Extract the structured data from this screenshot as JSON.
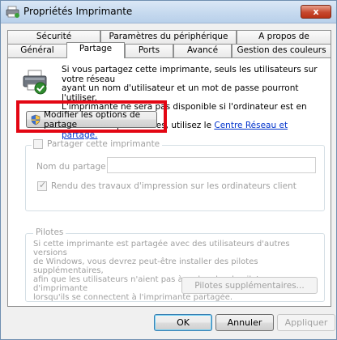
{
  "window": {
    "title": "Propriétés Imprimante",
    "close_label": "x"
  },
  "tabs": {
    "row1": [
      {
        "label": "Sécurité"
      },
      {
        "label": "Paramètres du périphérique"
      },
      {
        "label": "A propos de"
      }
    ],
    "row2": [
      {
        "label": "Général"
      },
      {
        "label": "Partage",
        "active": true
      },
      {
        "label": "Ports"
      },
      {
        "label": "Avancé"
      },
      {
        "label": "Gestion des couleurs"
      }
    ]
  },
  "sharing": {
    "info_line1": "Si vous partagez cette imprimante, seuls les utilisateurs sur votre réseau",
    "info_line2": "ayant un nom d'utilisateur et un mot de passe pourront l'utiliser.",
    "info_line3": "L'imprimante ne sera pas disponible si l'ordinateur est en veille. Pour",
    "info_line4": "modifier ces paramètres, utilisez le",
    "info_link": "Centre Réseau et partage.",
    "modify_button": "Modifier les options de partage",
    "share_checkbox_label": "Partager cette imprimante",
    "share_checkbox_checked": false,
    "share_name_label": "Nom du partage :",
    "share_name_value": "",
    "render_label": "Rendu des travaux d'impression sur les ordinateurs client",
    "render_checked": true
  },
  "drivers": {
    "title": "Pilotes",
    "line1": "Si cette imprimante est partagée avec des utilisateurs d'autres versions",
    "line2": "de Windows, vous devrez peut-être installer des pilotes supplémentaires,",
    "line3": "afin que les utilisateurs n'aient pas à rechercher le pilote d'imprimante",
    "line4": "lorsqu'ils se connectent à l'imprimante partagée.",
    "button": "Pilotes supplémentaires..."
  },
  "footer": {
    "ok": "OK",
    "cancel": "Annuler",
    "apply": "Appliquer"
  },
  "colors": {
    "highlight": "#e30613",
    "link": "#0033cc",
    "close": "#c7482e"
  }
}
